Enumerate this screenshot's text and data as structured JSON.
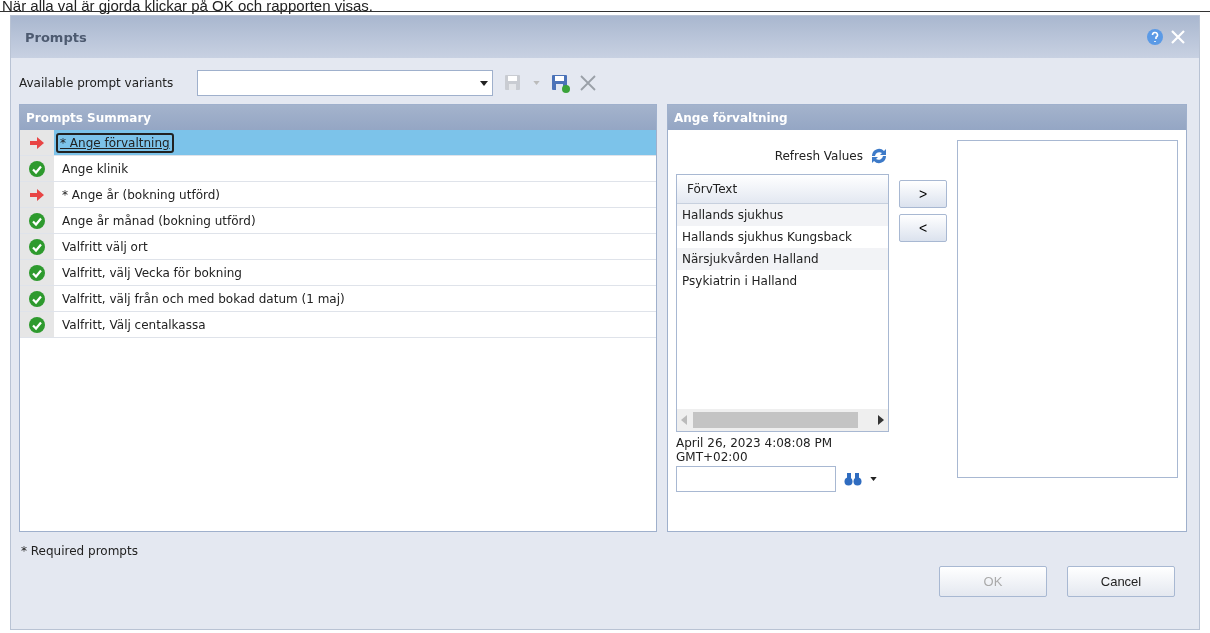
{
  "caption": "När alla val är gjorda klickar på OK och rapporten visas.",
  "window": {
    "title": "Prompts"
  },
  "variants": {
    "label": "Available prompt variants"
  },
  "summary": {
    "title": "Prompts Summary",
    "rows": [
      {
        "kind": "required",
        "text": "* Ange förvaltning",
        "selected": true
      },
      {
        "kind": "done",
        "text": "Ange klinik",
        "selected": false
      },
      {
        "kind": "required",
        "text": "* Ange år (bokning utförd)",
        "selected": false
      },
      {
        "kind": "done",
        "text": "Ange år månad (bokning utförd)",
        "selected": false
      },
      {
        "kind": "done",
        "text": "Valfritt välj ort",
        "selected": false
      },
      {
        "kind": "done",
        "text": "Valfritt, välj Vecka för bokning",
        "selected": false
      },
      {
        "kind": "done",
        "text": "Valfritt, välj från och med bokad datum (1 maj)",
        "selected": false
      },
      {
        "kind": "done",
        "text": "Valfritt, Välj centalkassa",
        "selected": false
      }
    ]
  },
  "detail": {
    "title": "Ange förvaltning",
    "refresh": "Refresh Values",
    "column": "FörvText",
    "values": [
      "Hallands sjukhus",
      "Hallands sjukhus Kungsback",
      "Närsjukvården Halland",
      "Psykiatrin i Halland"
    ],
    "add": ">",
    "remove": "<",
    "timestamp": "April 26, 2023 4:08:08 PM GMT+02:00"
  },
  "footnote": "* Required prompts",
  "buttons": [
    {
      "label": "OK",
      "disabled": true
    },
    {
      "label": "Cancel",
      "disabled": false
    }
  ]
}
